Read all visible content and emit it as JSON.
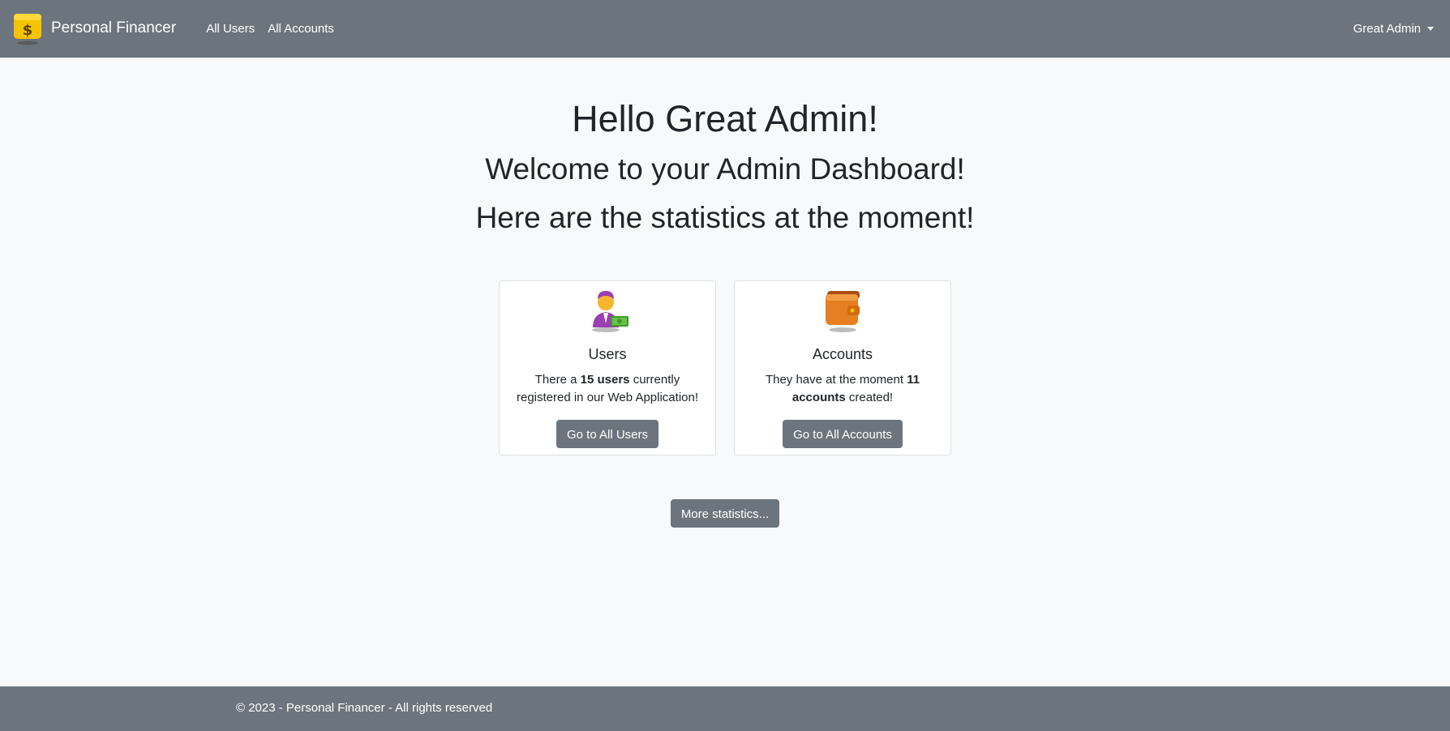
{
  "navbar": {
    "brand": "Personal Financer",
    "links": [
      "All Users",
      "All Accounts"
    ],
    "user": "Great Admin"
  },
  "hero": {
    "greeting": "Hello Great Admin!",
    "welcome": "Welcome to your Admin Dashboard!",
    "stats_intro": "Here are the statistics at the moment!"
  },
  "cards": {
    "users": {
      "icon": "user-money-icon",
      "title": "Users",
      "text_before": "There a ",
      "count": "15 users",
      "text_after": " currently registered in our Web Application!",
      "button": "Go to All Users"
    },
    "accounts": {
      "icon": "wallet-icon",
      "title": "Accounts",
      "text_before": "They have at the moment ",
      "count": "11 accounts",
      "text_after": " created!",
      "button": "Go to All Accounts"
    }
  },
  "more_button": "More statistics...",
  "footer": "© 2023 - Personal Financer - All rights reserved",
  "colors": {
    "navbar": "#6c757d",
    "background": "#f8f9fa",
    "button": "#6c757d",
    "logo_yellow": "#f5c400",
    "wallet_orange": "#e67e22",
    "user_purple": "#9b3fb3"
  }
}
